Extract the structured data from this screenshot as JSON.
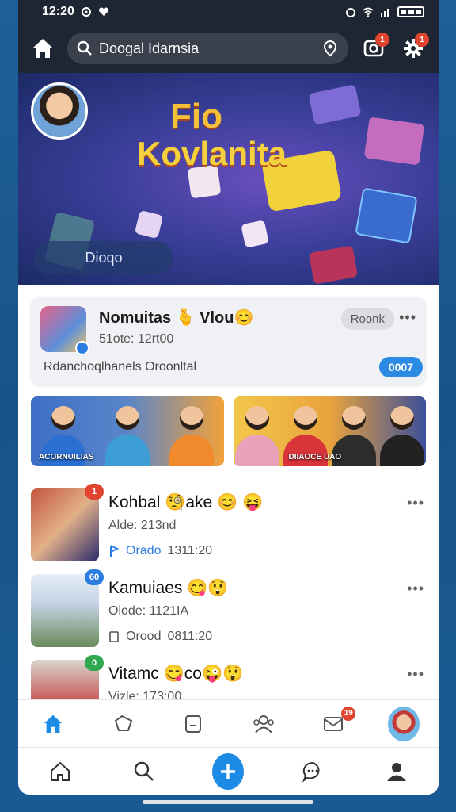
{
  "status_bar": {
    "time": "12:20"
  },
  "top_nav": {
    "search_text": "Doogal Idarnsia",
    "camera_badge": "1",
    "settings_badge": "1"
  },
  "hero": {
    "title_line1": "Fio",
    "title_line2": "Kovlanita",
    "pill_text": "Dioqo"
  },
  "feature_card": {
    "title": "Nomuitas 🫰 Vlou😊",
    "subtitle": "51ote: 12rt00",
    "caption": "Rdanchoqlhanels Oroonltal",
    "action_label": "Roonk",
    "count_label": "0007"
  },
  "strips": [
    {
      "label": "ACORNUILIAS"
    },
    {
      "label": "DIIAOCE UAO"
    }
  ],
  "feed": [
    {
      "name": "Kohbal 🧐ake 😊",
      "name_extra": "😝",
      "meta": "Alde: 213nd",
      "stats_prefix": "Orado",
      "stats_value": "1311:20",
      "badge": "1"
    },
    {
      "name": "Kamuiaes 😋😲",
      "name_extra": "",
      "meta": "Olode: 1121IA",
      "stats_prefix": "Orood",
      "stats_value": "0811:20",
      "badge": "60"
    },
    {
      "name": "Vitamc 😋co😜😲",
      "name_extra": "",
      "meta": "Vizle: 173:00",
      "stats_prefix": "",
      "stats_value": "",
      "badge": "0"
    }
  ],
  "bottom_tabs_upper": {
    "mail_badge": "19"
  },
  "colors": {
    "accent": "#1b8be6",
    "topbar": "#1f2633",
    "badge": "#e0442f"
  }
}
